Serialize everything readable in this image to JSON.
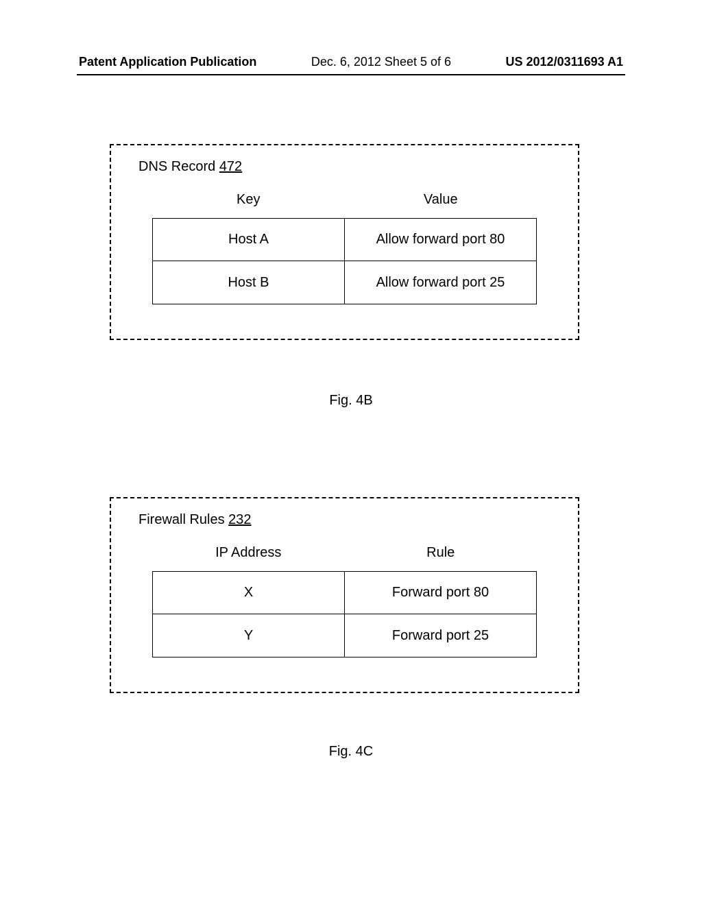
{
  "header": {
    "left": "Patent Application Publication",
    "center": "Dec. 6, 2012  Sheet 5 of 6",
    "right": "US 2012/0311693 A1"
  },
  "dns_record": {
    "title_text": "DNS Record ",
    "title_number": "472",
    "columns": [
      "Key",
      "Value"
    ],
    "rows": [
      {
        "key": "Host A",
        "value": "Allow forward port 80"
      },
      {
        "key": "Host B",
        "value": "Allow forward port 25"
      }
    ]
  },
  "firewall_rules": {
    "title_text": "Firewall Rules ",
    "title_number": "232",
    "columns": [
      "IP Address",
      "Rule"
    ],
    "rows": [
      {
        "ip": "X",
        "rule": "Forward port 80"
      },
      {
        "ip": "Y",
        "rule": "Forward port 25"
      }
    ]
  },
  "captions": {
    "fig_4b": "Fig. 4B",
    "fig_4c": "Fig. 4C"
  }
}
